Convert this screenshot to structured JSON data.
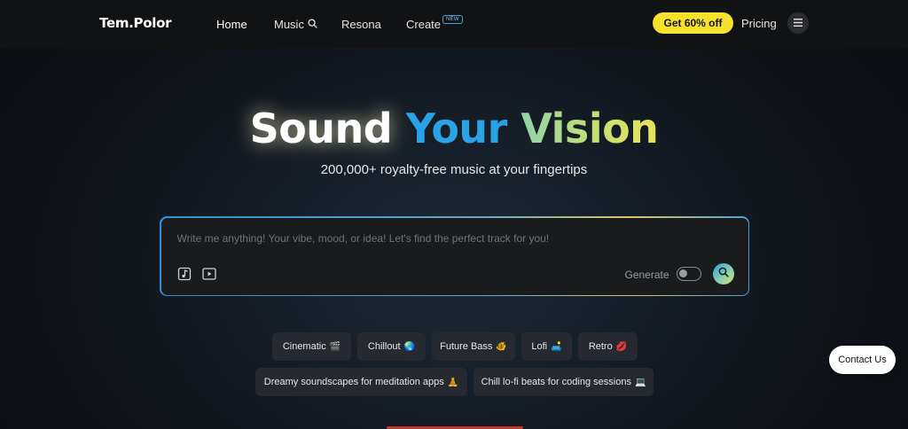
{
  "header": {
    "logo": "Tem.Polor",
    "nav": {
      "home": "Home",
      "music": "Music",
      "resona": "Resona",
      "create": "Create",
      "create_badge": "NEW",
      "pricing": "Pricing"
    },
    "promo": "Get 60% off"
  },
  "hero": {
    "title_part1": "Sound",
    "title_part2": "Your",
    "title_part3": "Vision",
    "subtitle": "200,000+ royalty-free music at your fingertips"
  },
  "search": {
    "placeholder": "Write me anything! Your vibe, mood, or idea! Let's find the perfect track for you!",
    "value": "",
    "generate_label": "Generate",
    "generate_on": false
  },
  "chips": [
    {
      "label": "Cinematic",
      "emoji": "🎬"
    },
    {
      "label": "Chillout",
      "emoji": "🌏"
    },
    {
      "label": "Future Bass",
      "emoji": "🐠"
    },
    {
      "label": "Lofi",
      "emoji": "🛋️"
    },
    {
      "label": "Retro",
      "emoji": "💋"
    },
    {
      "label": "Dreamy soundscapes for meditation apps",
      "emoji": "🧘"
    },
    {
      "label": "Chill lo-fi beats for coding sessions",
      "emoji": "💻"
    }
  ],
  "contact": "Contact Us",
  "colors": {
    "accent_yellow": "#f6e22c",
    "accent_blue": "#2aa3e6",
    "accent_green": "#8fd3a8",
    "chip_bg": "#262a30"
  },
  "icons": [
    "search-icon",
    "hamburger-menu-icon",
    "music-note-icon",
    "video-play-icon"
  ]
}
